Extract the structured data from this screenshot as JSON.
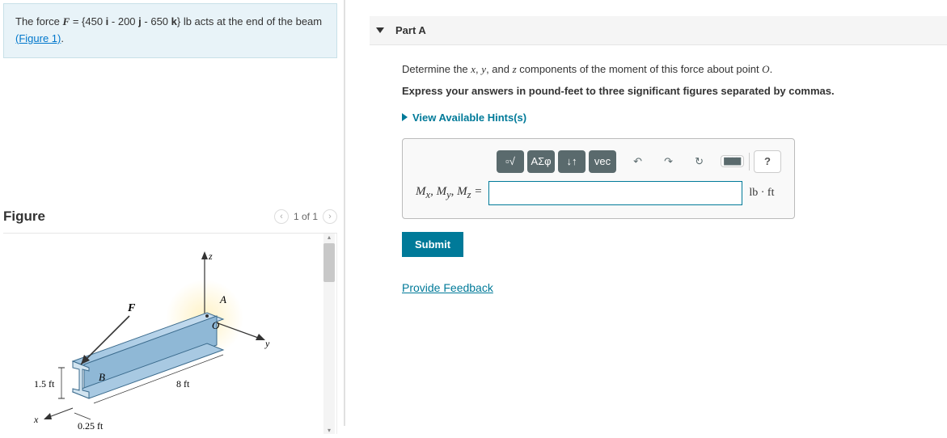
{
  "problem": {
    "prefix": "The force ",
    "F": "F",
    "eq": " = {450 ",
    "i": "i",
    "mid1": " - 200 ",
    "j": "j",
    "mid2": " - 650 ",
    "k": "k",
    "suffix": "} lb acts at the end of the beam ",
    "figlink": "(Figure 1)",
    "period": "."
  },
  "figure": {
    "title": "Figure",
    "pager": "1 of 1",
    "labels": {
      "F": "F",
      "A": "A",
      "O": "O",
      "B": "B",
      "x": "x",
      "y": "y",
      "z": "z",
      "len": "8 ft",
      "h": "1.5 ft",
      "w": "0.25 ft"
    }
  },
  "part": {
    "name": "Part A",
    "prompt_pre": "Determine the ",
    "x": "x",
    "y": "y",
    "z": "z",
    "c1": ", ",
    "c2": ", and ",
    "prompt_post": " components of the moment of this force about point ",
    "O": "O",
    "period": ".",
    "instruction": "Express your answers in pound-feet to three significant figures separated by commas.",
    "hints": "View Available Hints(s)",
    "answer_label_html": "Mₓ, Mᵧ, M_z =",
    "Mx": "M",
    "sx": "x",
    "My": "M",
    "sy": "y",
    "Mz": "M",
    "sz": "z",
    "eq": " = ",
    "unit": "lb · ft",
    "submit": "Submit"
  },
  "toolbar": {
    "sqrt": "▫√",
    "greek": "ΑΣφ",
    "scripts": "↓↑",
    "vec": "vec",
    "undo": "↶",
    "redo": "↷",
    "reset": "↻",
    "kbd": "⌨",
    "help": "?"
  },
  "feedback": "Provide Feedback"
}
